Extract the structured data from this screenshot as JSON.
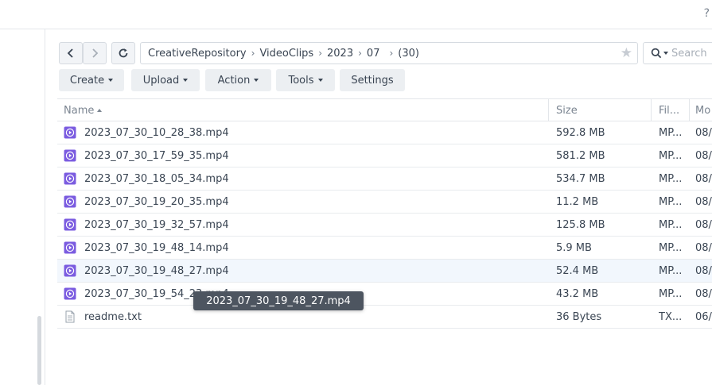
{
  "topbar": {
    "help_label": "?"
  },
  "path": {
    "crumbs": [
      "CreativeRepository",
      "VideoClips",
      "2023",
      "07"
    ],
    "count": "(30)",
    "separator": "›"
  },
  "search": {
    "placeholder": "Search"
  },
  "toolbar": {
    "create_label": "Create",
    "upload_label": "Upload",
    "action_label": "Action",
    "tools_label": "Tools",
    "settings_label": "Settings"
  },
  "grid": {
    "columns": [
      "Name",
      "Size",
      "Fil...",
      "Mo"
    ],
    "sort_column": "Name",
    "rows": [
      {
        "name": "2023_07_30_10_28_38.mp4",
        "size": "592.8 MB",
        "type": "MP...",
        "modified": "08/",
        "icon": "video-file-icon"
      },
      {
        "name": "2023_07_30_17_59_35.mp4",
        "size": "581.2 MB",
        "type": "MP...",
        "modified": "08/",
        "icon": "video-file-icon"
      },
      {
        "name": "2023_07_30_18_05_34.mp4",
        "size": "534.7 MB",
        "type": "MP...",
        "modified": "08/",
        "icon": "video-file-icon"
      },
      {
        "name": "2023_07_30_19_20_35.mp4",
        "size": "11.2 MB",
        "type": "MP...",
        "modified": "08/",
        "icon": "video-file-icon"
      },
      {
        "name": "2023_07_30_19_32_57.mp4",
        "size": "125.8 MB",
        "type": "MP...",
        "modified": "08/",
        "icon": "video-file-icon"
      },
      {
        "name": "2023_07_30_19_48_14.mp4",
        "size": "5.9 MB",
        "type": "MP...",
        "modified": "08/",
        "icon": "video-file-icon"
      },
      {
        "name": "2023_07_30_19_48_27.mp4",
        "size": "52.4 MB",
        "type": "MP...",
        "modified": "08/",
        "icon": "video-file-icon"
      },
      {
        "name": "2023_07_30_19_54_23.mp4",
        "size": "43.2 MB",
        "type": "MP...",
        "modified": "08/",
        "icon": "video-file-icon"
      },
      {
        "name": "readme.txt",
        "size": "36 Bytes",
        "type": "TX...",
        "modified": "06/",
        "icon": "text-file-icon"
      }
    ]
  },
  "tooltip": {
    "text": "2023_07_30_19_48_27.mp4"
  },
  "colors": {
    "video_icon": "#7b5ce0",
    "selected_row": "#f2f7fd",
    "tooltip_bg": "#4d5560"
  },
  "icons": [
    "back-arrow-icon",
    "forward-arrow-icon",
    "refresh-icon",
    "star-icon",
    "search-icon",
    "video-file-icon",
    "text-file-icon"
  ]
}
